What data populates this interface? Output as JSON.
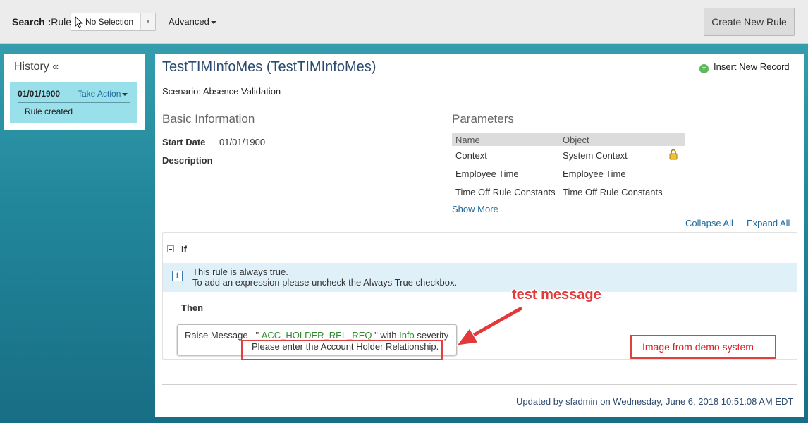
{
  "topbar": {
    "search_label_bold": "Search :",
    "search_label_rest": "Rule",
    "search_select_value": "No Selection",
    "advanced_label": "Advanced",
    "create_button": "Create New Rule"
  },
  "history": {
    "title": "History «",
    "date": "01/01/1900",
    "take_action": "Take Action",
    "note": "Rule created"
  },
  "rule": {
    "title": "TestTIMInfoMes (TestTIMInfoMes)",
    "insert_record": "Insert New Record",
    "scenario": "Scenario: Absence Validation",
    "basic_info_heading": "Basic Information",
    "start_date_label": "Start Date",
    "start_date_value": "01/01/1900",
    "description_label": "Description",
    "parameters_heading": "Parameters",
    "param_col_name": "Name",
    "param_col_object": "Object",
    "parameters": [
      {
        "name": "Context",
        "object": "System Context"
      },
      {
        "name": "Employee Time",
        "object": "Employee Time"
      },
      {
        "name": "Time Off Rule Constants",
        "object": "Time Off Rule Constants"
      }
    ],
    "show_more": "Show More",
    "collapse_all": "Collapse All",
    "expand_all": "Expand All",
    "if_label": "If",
    "info_line1": "This rule is always true.",
    "info_line2": "To add an expression please uncheck the Always True checkbox.",
    "then_label": "Then",
    "msg_prefix": "Raise Message",
    "msg_quote_open": "\"",
    "msg_code": "ACC_HOLDER_REL_REQ",
    "msg_quote_close": "\" with",
    "msg_severity": "Info",
    "msg_suffix": "severity",
    "msg_text": "Please enter the Account Holder Relationship.",
    "updated_by": "Updated by sfadmin on Wednesday, June 6, 2018 10:51:08 AM EDT"
  },
  "annotations": {
    "test_message": "test message",
    "demo_note": "Image from demo system"
  },
  "colors": {
    "link": "#1f6a9c",
    "title": "#2b4a6e",
    "history_card": "#99e0ea",
    "annotation_red": "#e04040",
    "code_green": "#2e8b2e"
  }
}
